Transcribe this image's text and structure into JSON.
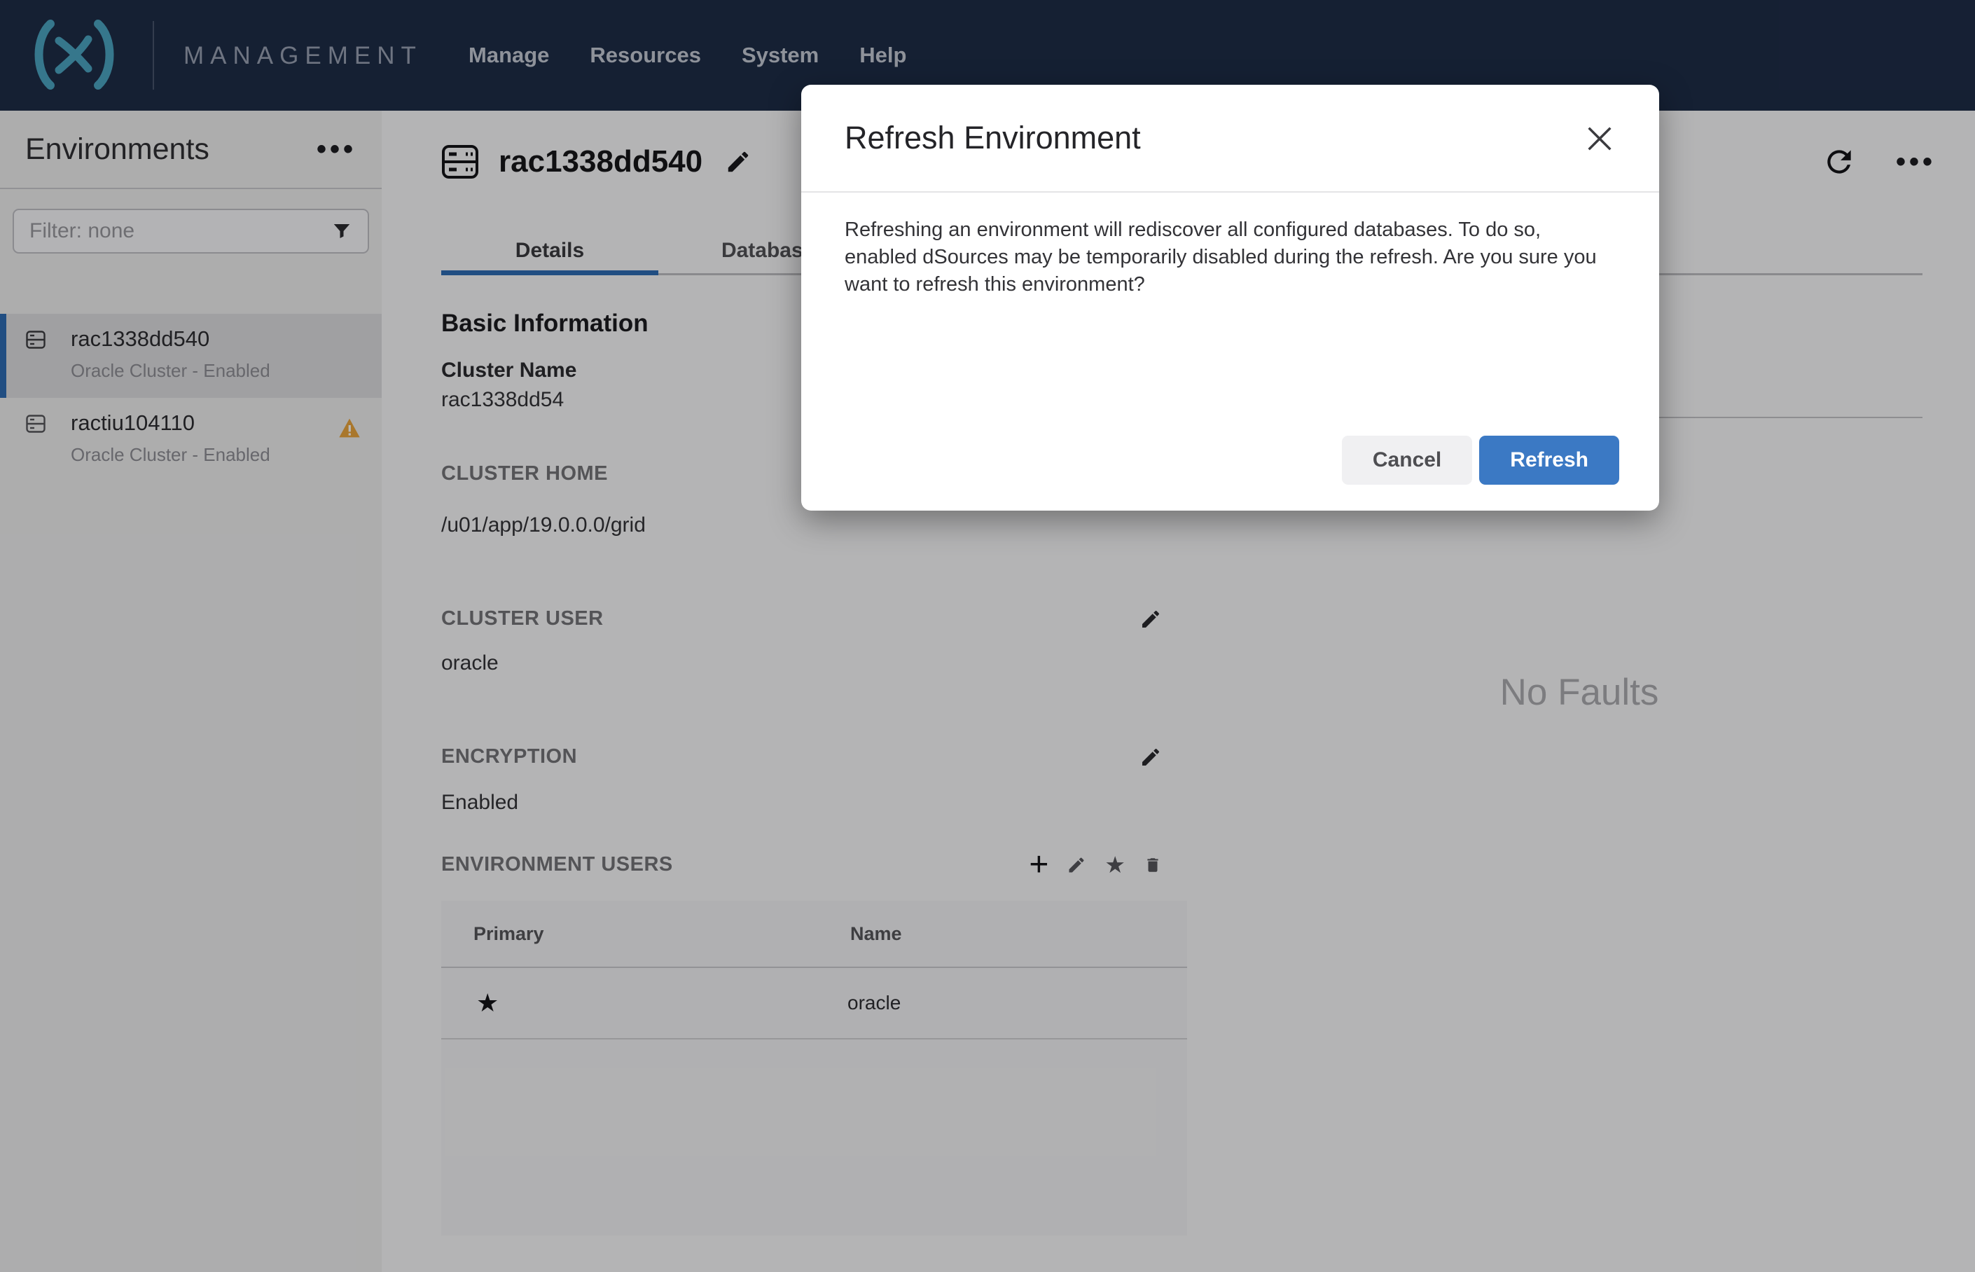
{
  "topnav": {
    "product": "MANAGEMENT",
    "links": [
      {
        "label": "Manage"
      },
      {
        "label": "Resources"
      },
      {
        "label": "System"
      },
      {
        "label": "Help"
      }
    ]
  },
  "sidebar": {
    "title": "Environments",
    "filter_placeholder": "Filter: none",
    "items": [
      {
        "name": "rac1338dd540",
        "status": "Oracle Cluster - Enabled",
        "selected": true,
        "warning": false
      },
      {
        "name": "ractiu104110",
        "status": "Oracle Cluster - Enabled",
        "selected": false,
        "warning": true
      }
    ]
  },
  "main": {
    "title": "rac1338dd540",
    "tabs": [
      {
        "label": "Details",
        "active": true
      },
      {
        "label": "Databases",
        "active": false
      }
    ],
    "sections": {
      "basic_info_heading": "Basic Information",
      "cluster_name_label": "Cluster Name",
      "cluster_name_value": "rac1338dd54",
      "cluster_home_label": "CLUSTER HOME",
      "cluster_home_value": "/u01/app/19.0.0.0/grid",
      "cluster_user_label": "CLUSTER USER",
      "cluster_user_value": "oracle",
      "encryption_label": "ENCRYPTION",
      "encryption_value": "Enabled",
      "env_users_label": "ENVIRONMENT USERS"
    },
    "users_table": {
      "columns": [
        "Primary",
        "Name"
      ],
      "rows": [
        {
          "primary": true,
          "name": "oracle"
        }
      ]
    },
    "faults": {
      "empty_text": "No Faults"
    }
  },
  "modal": {
    "title": "Refresh Environment",
    "body": "Refreshing an environment will rediscover all configured databases. To do so, enabled dSources may be temporarily disabled during the refresh. Are you sure you want to refresh this environment?",
    "cancel_label": "Cancel",
    "confirm_label": "Refresh"
  },
  "colors": {
    "accent_blue": "#3B79C4",
    "navy": "#1E2C47",
    "warning_amber": "#E8A33D",
    "logo_teal": "#4BA3C0",
    "tab_underline_blue": "#2E6CB2"
  }
}
